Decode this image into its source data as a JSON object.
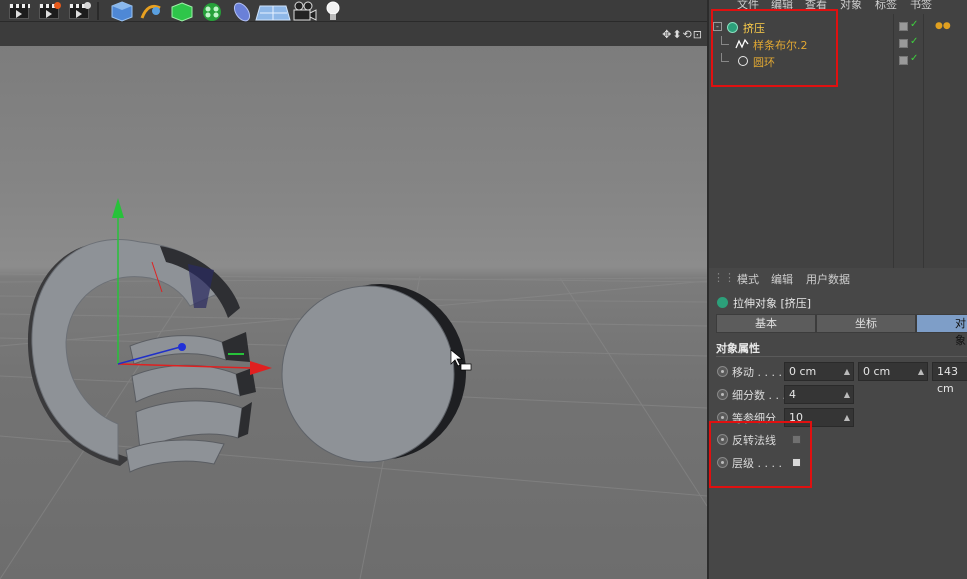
{
  "toolbar": {
    "buttons": [
      "render-view-icon",
      "render-picture-viewer-icon",
      "render-settings-icon",
      "cube-icon",
      "pen-spline-icon",
      "subdivision-icon",
      "array-icon",
      "deformer-icon",
      "floor-icon",
      "camera-icon",
      "light-icon"
    ]
  },
  "viewport": {
    "nav_icons": "✥⬍⟲⊡"
  },
  "object_manager": {
    "menu": [
      "文件",
      "编辑",
      "查看",
      "对象",
      "标签",
      "书签"
    ],
    "objects": [
      {
        "name": "挤压",
        "icon": "extrude-icon",
        "color": "#ffcf4a",
        "tag": "●●"
      },
      {
        "name": "样条布尔.2",
        "icon": "spline-boolean-icon",
        "color": "#e2a832"
      },
      {
        "name": "圆环",
        "icon": "circle-spline-icon",
        "color": "#e2a832"
      }
    ]
  },
  "attribute_manager": {
    "menu": [
      "模式",
      "编辑",
      "用户数据"
    ],
    "title": "拉伸对象 [挤压]",
    "tabs": [
      "基本",
      "坐标",
      "对象"
    ],
    "active_tab": "对象",
    "section": "对象属性",
    "move_label": "移动 . . . .",
    "move_x": "0 cm",
    "move_y": "0 cm",
    "move_z": "143 cm",
    "subdiv_label": "细分数 . . .",
    "subdiv_value": "4",
    "iso_label": "等参细分",
    "iso_value": "10",
    "flip_label": "反转法线",
    "hier_label": "层级 . . . ."
  },
  "colors": {
    "highlight_red": "#e01010",
    "active_tab": "#7e9ec8",
    "object_name": "#e2a832"
  }
}
